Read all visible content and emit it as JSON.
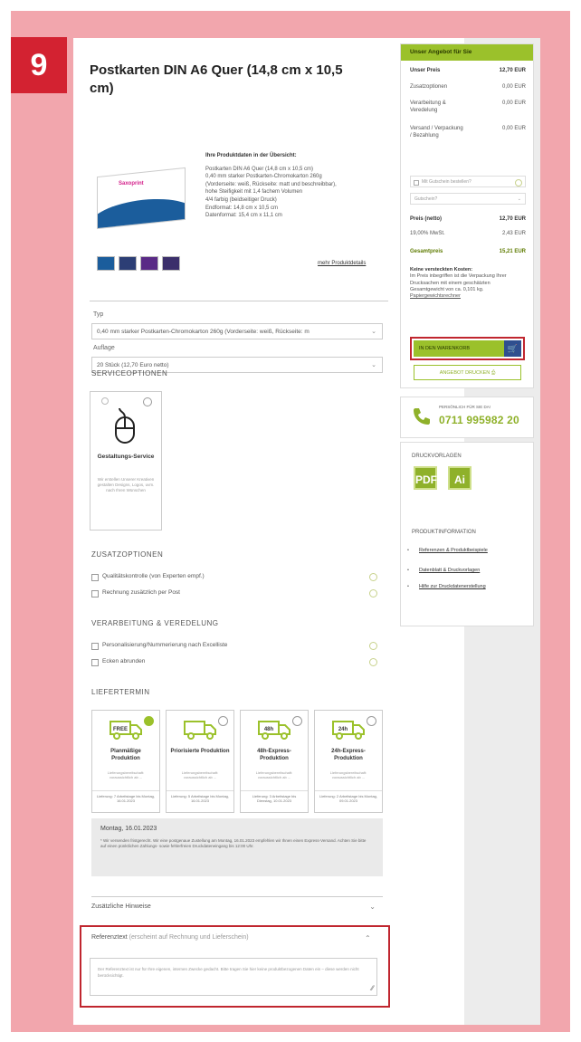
{
  "step_number": "9",
  "product": {
    "title": "Postkarten DIN A6 Quer (14,8 cm x 10,5 cm)",
    "hero_logo": "Saxoprint",
    "overview_heading": "Ihre Produktdaten in der Übersicht:",
    "overview_lines": [
      "Postkarten DIN A6 Quer (14,8 cm x 10,5 cm)",
      "0,40 mm starker Postkarten-Chromokarton 260g",
      "(Vorderseite: weiß, Rückseite: matt und beschreibbar),",
      "hohe Steifigkeit mit 1,4 fachem Volumen",
      "4/4 farbig (beidseitiger Druck)",
      "Endformat: 14,8 cm x 10,5 cm",
      "Datenformat: 15,4 cm x 11,1 cm"
    ],
    "more_link": "mehr Produktdetails"
  },
  "form": {
    "type_label": "Typ",
    "type_value": "0,40 mm starker Postkarten-Chromokarton 260g (Vorderseite: weiß, Rückseite: m",
    "run_label": "Auflage",
    "run_value": "20 Stück (12,70 Euro netto)"
  },
  "service": {
    "heading": "SERVICEOPTIONEN",
    "card_name": "Gestaltungs-Service",
    "card_desc": "Wir erstellen Unserer Kreativen gestalten Designs, Logos, uvm. nach Ihren Wünschen"
  },
  "extras": {
    "heading": "ZUSATZOPTIONEN",
    "items": [
      "Qualitätskontrolle (von Experten empf.)",
      "Rechnung zusätzlich per Post"
    ]
  },
  "finishing": {
    "heading": "VERARBEITUNG & VEREDELUNG",
    "items": [
      "Personalisierung/Nummerierung nach Excelliste",
      "Ecken abrunden"
    ]
  },
  "delivery": {
    "heading": "LIEFERTERMIN",
    "options": [
      {
        "tag": "FREE",
        "name": "Planmäßige Produktion",
        "sub": "Lieferungsbereitschaft: voraussichtlich ab ...",
        "foot": "Lieferung: 7 Arbeitstage bis Montag, 16.01.2023",
        "selected": true
      },
      {
        "tag": "",
        "name": "Priorisierte Produktion",
        "sub": "Lieferungsbereitschaft: voraussichtlich ab ...",
        "foot": "Lieferung: 5 Arbeitstage bis Montag, 16.01.2023",
        "selected": false
      },
      {
        "tag": "48h",
        "name": "48h-Express-Produktion",
        "sub": "Lieferungsbereitschaft: voraussichtlich ab ...",
        "foot": "Lieferung: 3 Arbeitstage bis Dienstag, 10.01.2023",
        "selected": false
      },
      {
        "tag": "24h",
        "name": "24h-Express-Produktion",
        "sub": "Lieferungsbereitschaft: voraussichtlich ab ...",
        "foot": "Lieferung: 2 Arbeitstage bis Montag, 09.01.2023",
        "selected": false
      }
    ]
  },
  "date_info": {
    "date": "Montag, 16.01.2023",
    "note": "* Wir versenden fristgerecht. Wir eine postgenaue Zustellung am Montag, 16.01.2023 empfehlen wir Ihnen einen Express-Versand. Achten Sie bitte auf einen pünktlichen Zahlungs- sowie fehlerfreien Druckdateneingang bis 12:00 Uhr."
  },
  "hints_label": "Zusätzliche Hinweise",
  "reference": {
    "title": "Referenztext",
    "subtitle": "(erscheint auf Rechnung und Lieferschein)",
    "placeholder": "Der Referenztext ist nur für Ihre eigenen, internen Zwecke gedacht. Bitte tragen Sie hier keine produktbezogenen Daten ein – diese werden nicht berücksichtigt."
  },
  "offer": {
    "heading": "Unser Angebot für Sie",
    "rows": [
      {
        "label": "Unser Preis",
        "value": "12,70 EUR"
      },
      {
        "label": "Zusatzoptionen",
        "value": "0,00 EUR"
      },
      {
        "label": "Verarbeitung & Veredelung",
        "value": "0,00 EUR"
      },
      {
        "label": "Versand / Verpackung / Bezahlung",
        "value": "0,00 EUR"
      }
    ],
    "promo_checkbox": "Mit Gutschein bestellen?",
    "voucher_placeholder": "Gutschein?",
    "net_label": "Preis (netto)",
    "net_value": "12,70 EUR",
    "vat_label": "19,00% MwSt.",
    "vat_value": "2,43 EUR",
    "total_label": "Gesamtpreis",
    "total_value": "15,21 EUR",
    "hidden_costs_title": "Keine versteckten Kosten:",
    "hidden_costs_text": "Im Preis inbegriffen ist die Verpackung Ihrer Drucksachen mit einem geschätzten Gesamtgewicht von ca. 0,101 kg.",
    "weight_link": "Papiergewichtsrechner",
    "cart_button": "IN DEN WARENKORB",
    "print_button": "ANGEBOT DRUCKEN"
  },
  "contact": {
    "label": "PERSÖNLICH FÜR SIE DA!",
    "phone": "0711 995982 20"
  },
  "templates": {
    "heading": "DRUCKVORLAGEN",
    "pdf_icon": "PDF",
    "ai_icon": "Ai"
  },
  "product_info": {
    "heading": "PRODUKTINFORMATION",
    "links": [
      "Referenzen & Produktbeispiele",
      "Datenblatt & Druckvorlagen",
      "Hilfe zur Druckdatenerstellung"
    ]
  },
  "colors": {
    "accent_green": "#9bc12b",
    "highlight_red": "#c0262f",
    "brand_blue": "#2f4f8f",
    "background_pink": "#f2a6ad"
  }
}
